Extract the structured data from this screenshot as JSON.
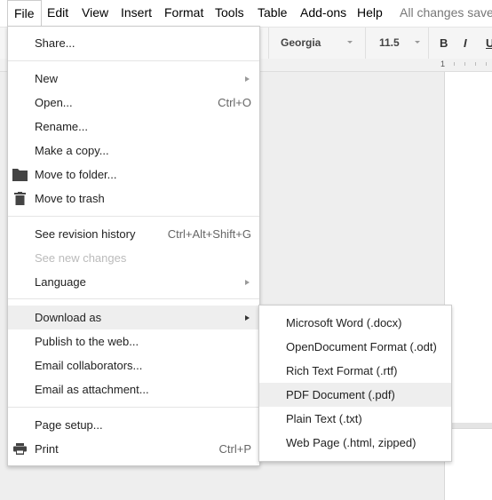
{
  "menubar": {
    "items": [
      "File",
      "Edit",
      "View",
      "Insert",
      "Format",
      "Tools",
      "Table",
      "Add-ons",
      "Help"
    ],
    "status": "All changes saved in Drive"
  },
  "toolbar": {
    "font": "Georgia",
    "font_size": "11.5",
    "bold": "B",
    "italic": "I",
    "underline": "U"
  },
  "ruler": {
    "first_number": "1"
  },
  "file_menu": {
    "share": "Share...",
    "new": "New",
    "open": "Open...",
    "open_shortcut": "Ctrl+O",
    "rename": "Rename...",
    "make_copy": "Make a copy...",
    "move_to_folder": "Move to folder...",
    "move_to_trash": "Move to trash",
    "revision_history": "See revision history",
    "revision_history_shortcut": "Ctrl+Alt+Shift+G",
    "see_new_changes": "See new changes",
    "language": "Language",
    "download_as": "Download as",
    "publish": "Publish to the web...",
    "email_collaborators": "Email collaborators...",
    "email_attachment": "Email as attachment...",
    "page_setup": "Page setup...",
    "print": "Print",
    "print_shortcut": "Ctrl+P"
  },
  "download_menu": {
    "items": [
      "Microsoft Word (.docx)",
      "OpenDocument Format (.odt)",
      "Rich Text Format (.rtf)",
      "PDF Document (.pdf)",
      "Plain Text (.txt)",
      "Web Page (.html, zipped)"
    ],
    "highlighted_index": 3
  }
}
